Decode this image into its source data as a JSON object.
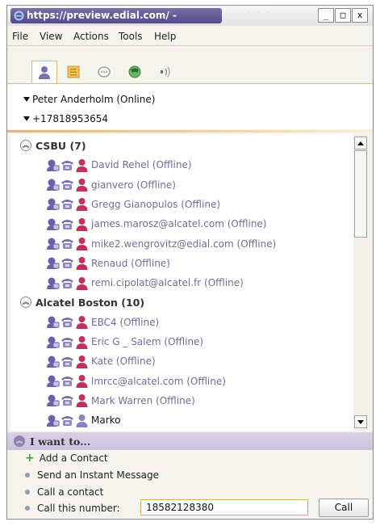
{
  "window": {
    "title": "https://preview.edial.com/ -",
    "minimize": "_",
    "maximize": "□",
    "close": "x"
  },
  "menu": [
    "File",
    "View",
    "Actions",
    "Tools",
    "Help"
  ],
  "tabs": [
    {
      "icon": "person-icon",
      "active": true
    },
    {
      "icon": "notepad-icon"
    },
    {
      "icon": "chat-icon"
    },
    {
      "icon": "globe-phone-icon"
    },
    {
      "icon": "sound-icon"
    }
  ],
  "status": {
    "user": "Peter Anderholm (Online)",
    "phone": "+17818953654"
  },
  "groups": [
    {
      "name": "CSBU (7)",
      "contacts": [
        {
          "name": "David Rehel (Offline)"
        },
        {
          "name": "gianvero (Offline)"
        },
        {
          "name": "Gregg Gianopulos (Offline)"
        },
        {
          "name": "james.marosz@alcatel.com (Offline)"
        },
        {
          "name": "mike2.wengrovitz@edial.com (Offline)"
        },
        {
          "name": "Renaud (Offline)"
        },
        {
          "name": "remi.cipolat@alcatel.fr (Offline)"
        }
      ]
    },
    {
      "name": "Alcatel Boston (10)",
      "contacts": [
        {
          "name": "EBC4 (Offline)"
        },
        {
          "name": "Eric G _ Salem (Offline)"
        },
        {
          "name": "Kate (Offline)"
        },
        {
          "name": "lmrcc@alcatel.com (Offline)"
        },
        {
          "name": "Mark Warren (Offline)"
        },
        {
          "name": "Marko"
        }
      ]
    }
  ],
  "actions": {
    "header": "I want to...",
    "add_contact": "Add a Contact",
    "send_im": "Send an Instant Message",
    "call_contact": "Call a contact",
    "call_number_label": "Call this number:",
    "call_number_value": "18582128380",
    "call_button": "Call"
  },
  "colors": {
    "accent": "#e9b66a",
    "title_bar": "#54498a",
    "offline_text": "#6e6e9c",
    "panel_header": "#cbc1dd"
  }
}
